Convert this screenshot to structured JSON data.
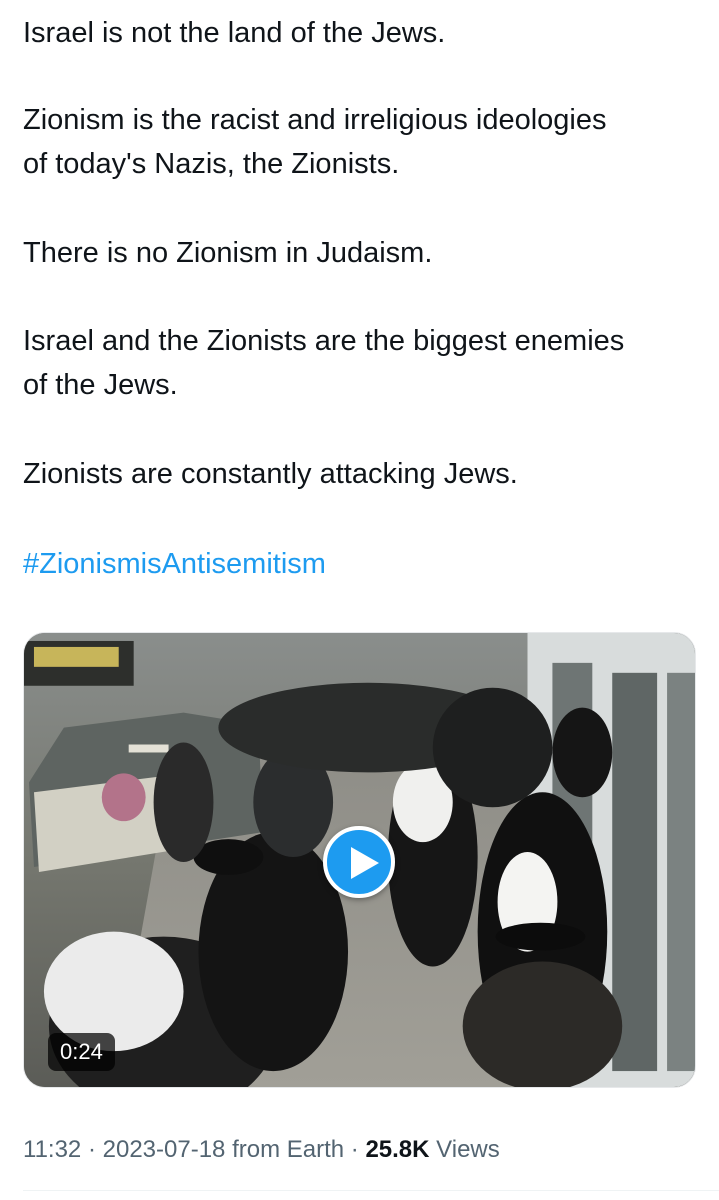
{
  "tweet": {
    "paragraphs": [
      {
        "lines": [
          "Israel is not the land of the Jews."
        ]
      },
      {
        "lines": [
          "Zionism is the racist and irreligious ideologies",
          "of today's Nazis, the Zionists."
        ]
      },
      {
        "lines": [
          "There is no Zionism in Judaism."
        ]
      },
      {
        "lines": [
          "Israel and the Zionists are the biggest enemies",
          "of the Jews."
        ]
      },
      {
        "lines": [
          "Zionists are constantly attacking Jews."
        ]
      }
    ],
    "hashtag": "#ZionismisAntisemitism",
    "hashtag_color": "#1d9bf0"
  },
  "media": {
    "type": "video",
    "duration": "0:24",
    "play_icon": "play-icon",
    "accent": "#1d9bf0"
  },
  "meta": {
    "time": "11:32",
    "separator": "·",
    "date": "2023-07-18",
    "source": "from Earth",
    "views_count": "25.8K",
    "views_label": "Views"
  }
}
